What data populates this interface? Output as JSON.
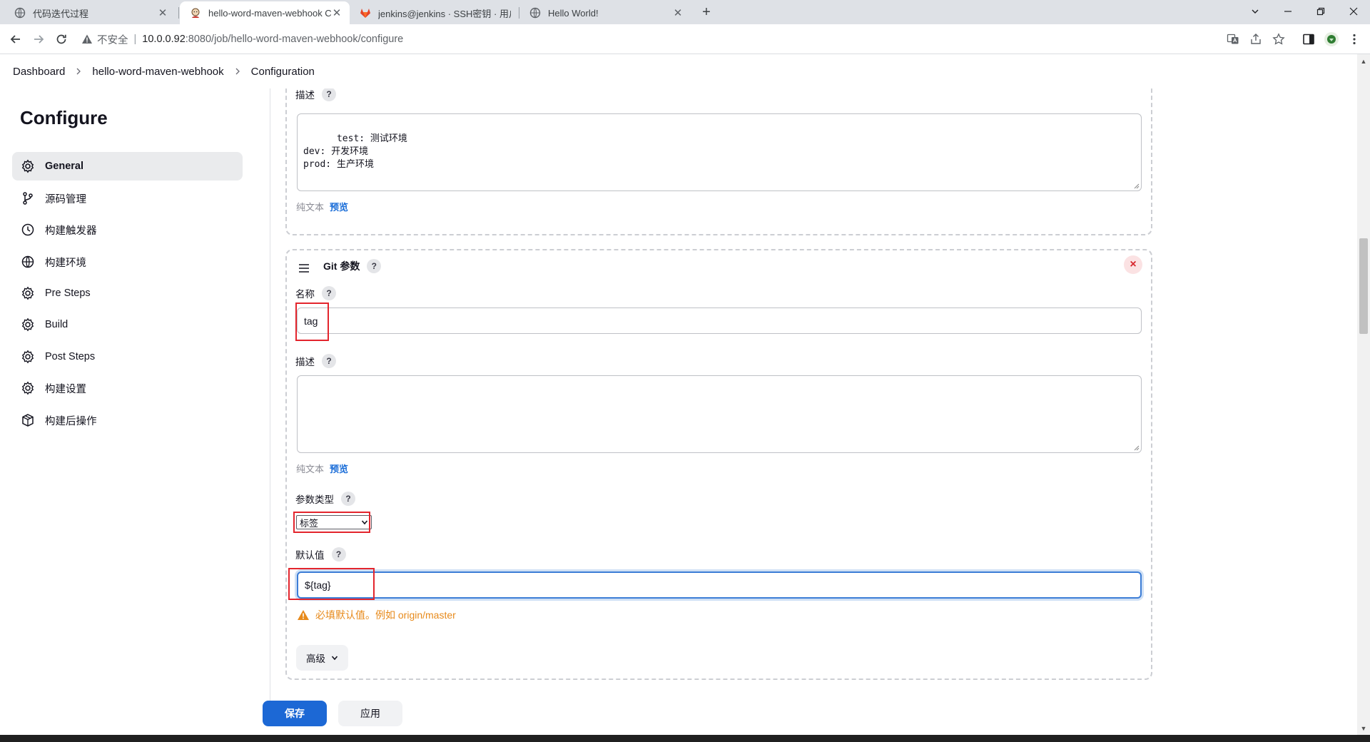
{
  "browser": {
    "tabs": [
      {
        "title": "代码迭代过程",
        "icon": "globe-icon"
      },
      {
        "title": "hello-word-maven-webhook Config",
        "icon": "jenkins-icon"
      },
      {
        "title": "jenkins@jenkins · SSH密钥 · 用户设置",
        "icon": "gitlab-icon"
      },
      {
        "title": "Hello World!",
        "icon": "globe-icon"
      }
    ],
    "new_tab": "+",
    "address": {
      "insecure_label": "不安全",
      "host": "10.0.0.92",
      "path": ":8080/job/hello-word-maven-webhook/configure"
    }
  },
  "breadcrumb": [
    "Dashboard",
    "hello-word-maven-webhook",
    "Configuration"
  ],
  "sidebar": {
    "title": "Configure",
    "items": [
      {
        "label": "General",
        "icon": "gear-icon",
        "active": true
      },
      {
        "label": "源码管理",
        "icon": "branch-icon"
      },
      {
        "label": "构建触发器",
        "icon": "clock-icon"
      },
      {
        "label": "构建环境",
        "icon": "globe-icon"
      },
      {
        "label": "Pre Steps",
        "icon": "gear-icon"
      },
      {
        "label": "Build",
        "icon": "gear-icon"
      },
      {
        "label": "Post Steps",
        "icon": "gear-icon"
      },
      {
        "label": "构建设置",
        "icon": "gear-icon"
      },
      {
        "label": "构建后操作",
        "icon": "package-icon"
      }
    ]
  },
  "choice_param": {
    "desc_label": "描述",
    "desc_value": "test: 测试环境\ndev: 开发环境\nprod: 生产环境",
    "format_plain": "纯文本",
    "format_preview": "预览"
  },
  "git_param": {
    "header": "Git 参数",
    "name_label": "名称",
    "name_value": "tag",
    "desc_label": "描述",
    "desc_value": "",
    "format_plain": "纯文本",
    "format_preview": "预览",
    "type_label": "参数类型",
    "type_value": "标签",
    "default_label": "默认值",
    "default_value": "${tag}",
    "warning": "必填默认值。例如 origin/master",
    "advanced_label": "高级",
    "help_glyph": "?",
    "close_glyph": "×"
  },
  "actions": {
    "save": "保存",
    "apply": "应用"
  },
  "colors": {
    "primary": "#1c68d5",
    "highlight": "#e3252d",
    "warning": "#e78a1b"
  }
}
